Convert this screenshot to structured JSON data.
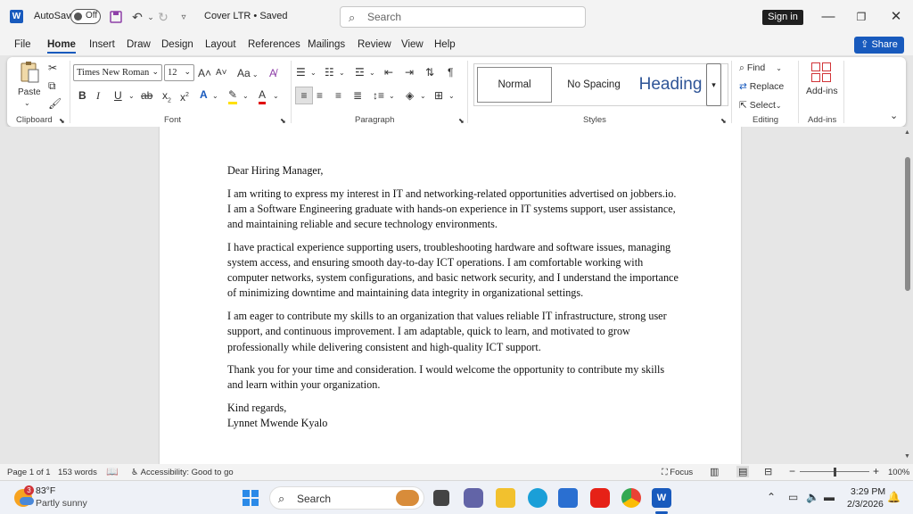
{
  "titlebar": {
    "app_icon": "W",
    "autosave_label": "AutoSave",
    "autosave_state": "Off",
    "document_name": "Cover LTR • Saved",
    "search_placeholder": "Search",
    "signin_label": "Sign in"
  },
  "menu": {
    "items": [
      "File",
      "Home",
      "Insert",
      "Draw",
      "Design",
      "Layout",
      "References",
      "Mailings",
      "Review",
      "View",
      "Help"
    ],
    "active": "Home",
    "share_label": "Share"
  },
  "ribbon": {
    "clipboard": {
      "paste_label": "Paste",
      "group_label": "Clipboard"
    },
    "font": {
      "font_name": "Times New Roman",
      "font_size": "12",
      "group_label": "Font",
      "case_label": "Aa"
    },
    "paragraph": {
      "group_label": "Paragraph"
    },
    "styles": {
      "tiles": [
        "Normal",
        "No Spacing",
        "Heading"
      ],
      "selected": "Normal",
      "group_label": "Styles"
    },
    "editing": {
      "find_label": "Find",
      "replace_label": "Replace",
      "select_label": "Select",
      "group_label": "Editing"
    },
    "addins": {
      "button_label": "Add-ins",
      "group_label": "Add-ins"
    }
  },
  "document": {
    "greeting": "Dear Hiring Manager,",
    "paragraphs": [
      "I am writing to express my interest in IT and networking-related opportunities advertised on jobbers.io. I am a Software Engineering graduate with hands-on experience in IT systems support, user assistance, and maintaining reliable and secure technology environments.",
      "I have practical experience supporting users, troubleshooting hardware and software issues, managing system access, and ensuring smooth day-to-day ICT operations. I am comfortable working with computer networks, system configurations, and basic network security, and I understand the importance of minimizing downtime and maintaining data integrity in organizational settings.",
      "I am eager to contribute my skills to an organization that values reliable IT infrastructure, strong user support, and continuous improvement. I am adaptable, quick to learn, and motivated to grow professionally while delivering consistent and high-quality ICT support.",
      "Thank you for your time and consideration. I would welcome the opportunity to contribute my skills and learn within your organization."
    ],
    "closing": "Kind regards,",
    "signature": "Lynnet Mwende Kyalo"
  },
  "statusbar": {
    "page": "Page 1 of 1",
    "words": "153 words",
    "accessibility": "Accessibility: Good to go",
    "focus": "Focus",
    "zoom": "100%"
  },
  "taskbar": {
    "temperature": "83°F",
    "weather": "Partly sunny",
    "weather_badge": "3",
    "search_label": "Search",
    "time": "3:29 PM",
    "date": "2/3/2026"
  },
  "colors": {
    "accent": "#185abd",
    "taskbar": "#eef1f7",
    "chrome": "#f3f3f3"
  }
}
